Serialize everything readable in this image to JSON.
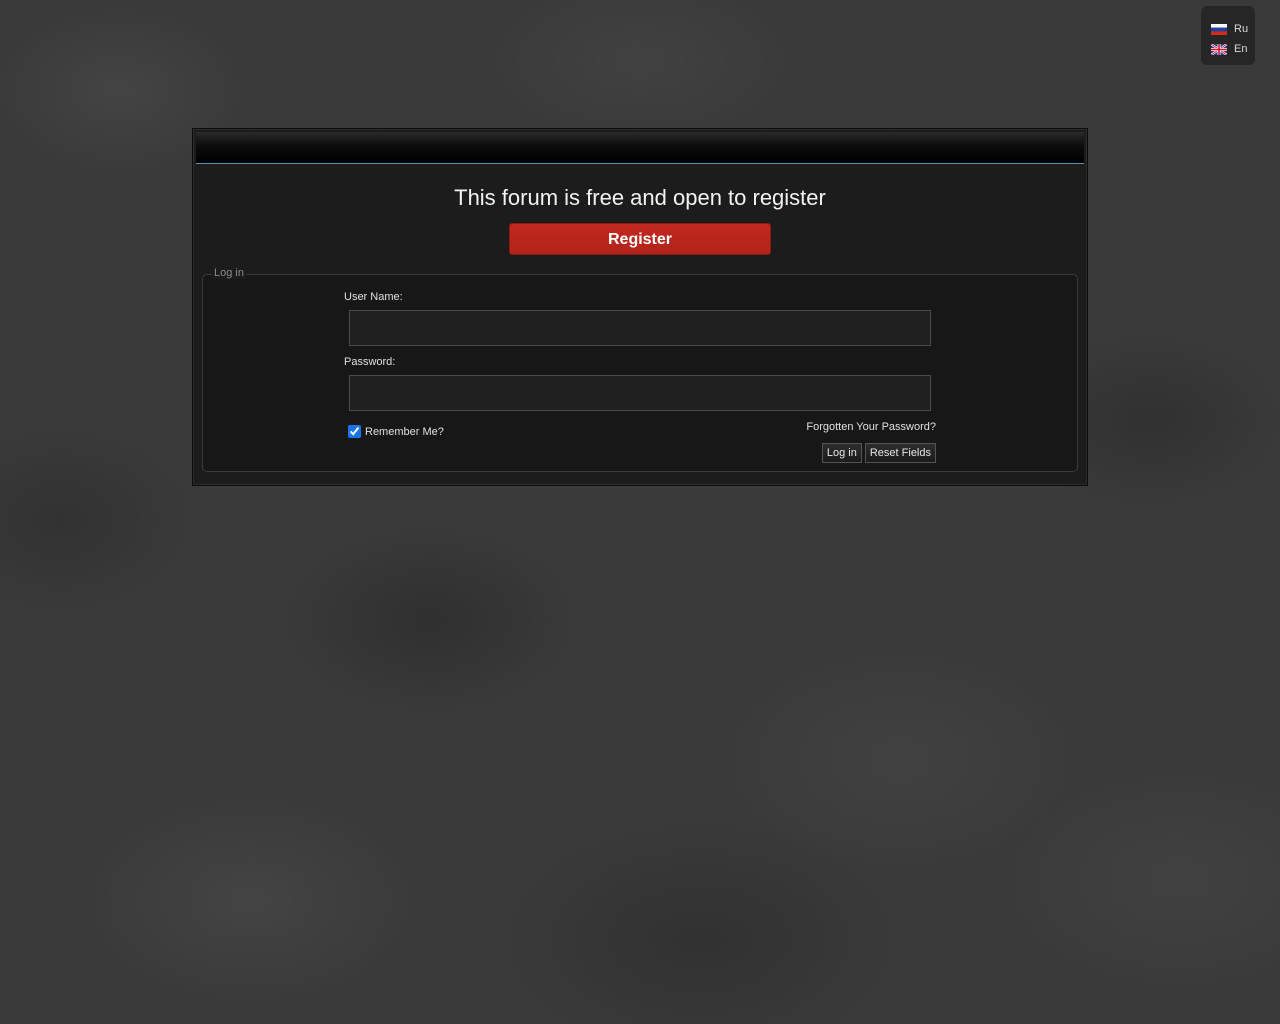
{
  "language_switcher": {
    "items": [
      {
        "label": "Ru",
        "icon": "russia-flag-icon"
      },
      {
        "label": "En",
        "icon": "uk-flag-icon"
      }
    ]
  },
  "register_section": {
    "title": "This forum is free and open to register",
    "button_label": "Register",
    "button_color": "#b8261c"
  },
  "login": {
    "legend": "Log in",
    "username_label": "User Name:",
    "username_value": "",
    "password_label": "Password:",
    "password_value": "",
    "remember_label": "Remember Me?",
    "remember_checked": true,
    "forgot_link": "Forgotten Your Password?",
    "login_button": "Log in",
    "reset_button": "Reset Fields"
  },
  "colors": {
    "header_border_accent": "#5e93b8",
    "panel_background": "#1c1c1c"
  }
}
